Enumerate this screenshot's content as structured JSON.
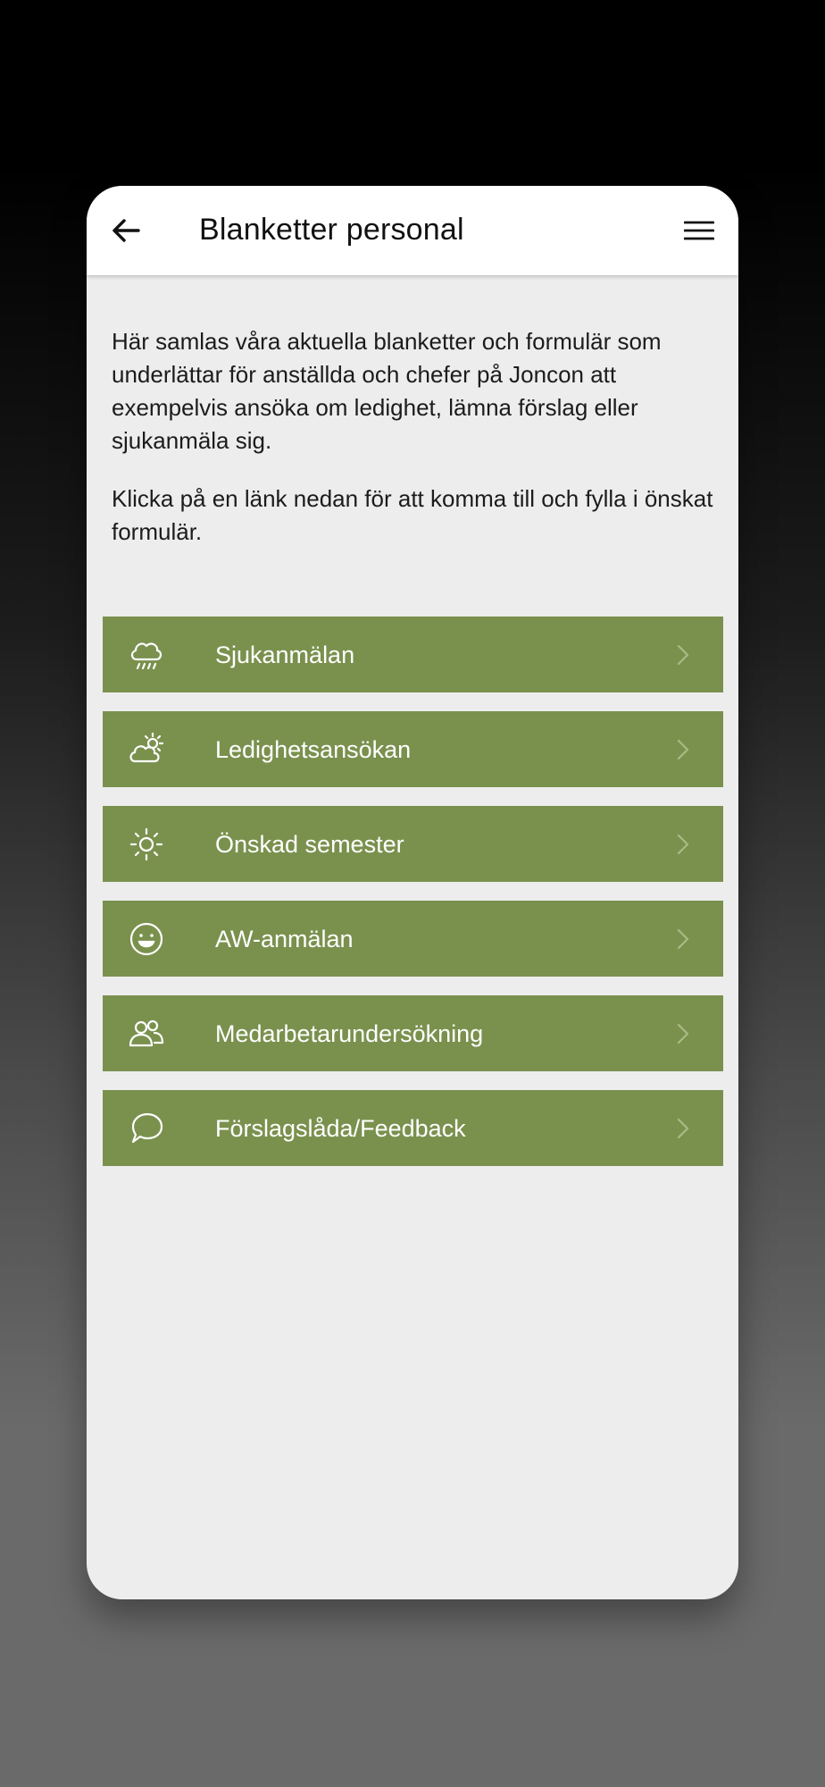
{
  "header": {
    "title": "Blanketter personal",
    "back_icon": "arrow-left-icon",
    "menu_icon": "hamburger-menu-icon"
  },
  "intro": {
    "paragraph1": "Här samlas våra aktuella blanketter och formulär som underlättar för anställda och chefer på Joncon att exempelvis ansöka om ledighet, lämna förslag eller sjukanmäla sig.",
    "paragraph2": "Klicka på en länk nedan för att komma till och fylla i önskat formulär."
  },
  "links": [
    {
      "label": "Sjukanmälan",
      "icon": "rain-cloud-icon"
    },
    {
      "label": "Ledighetsansökan",
      "icon": "partly-sunny-icon"
    },
    {
      "label": "Önskad semester",
      "icon": "sun-icon"
    },
    {
      "label": "AW-anmälan",
      "icon": "smiley-icon"
    },
    {
      "label": "Medarbetarundersökning",
      "icon": "people-icon"
    },
    {
      "label": "Förslagslåda/Feedback",
      "icon": "chat-bubble-icon"
    }
  ],
  "colors": {
    "accent_green": "#7a914e",
    "app_bar": "#ffffff",
    "content_bg": "#ededed"
  }
}
